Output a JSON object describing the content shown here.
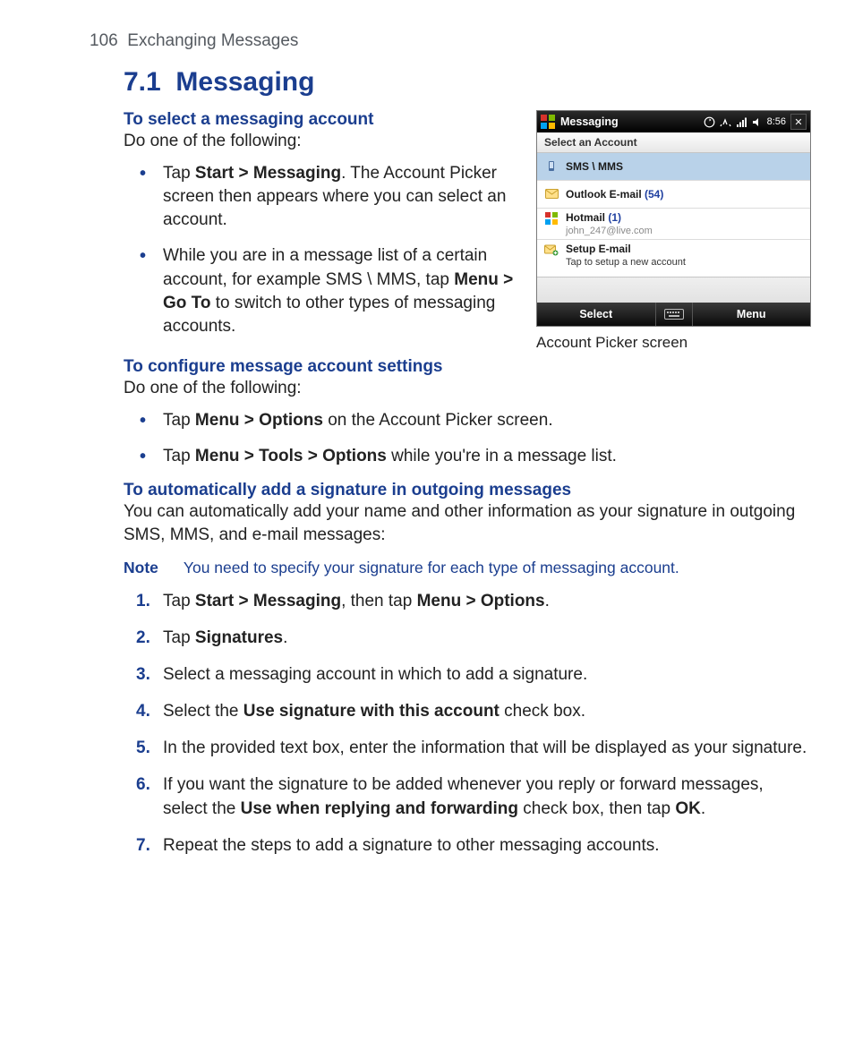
{
  "page": {
    "number": "106",
    "running_head": "Exchanging Messages",
    "section_number": "7.1",
    "section_title": "Messaging"
  },
  "s1": {
    "heading": "To select a messaging account",
    "intro": "Do one of the following:",
    "b1_pre": "Tap ",
    "b1_bold": "Start > Messaging",
    "b1_post": ". The Account Picker screen then appears where you can select an account.",
    "b2_pre": "While you are in a message list of a certain account, for example SMS \\ MMS, tap ",
    "b2_bold": "Menu > Go To",
    "b2_post": " to switch to other types of messaging accounts."
  },
  "shot": {
    "title": "Messaging",
    "time": "8:56",
    "subhead": "Select an Account",
    "rows": {
      "sms": {
        "label": "SMS \\ MMS"
      },
      "outlook": {
        "label_pre": "Outlook E-mail  ",
        "count": "(54)"
      },
      "hotmail": {
        "label_pre": "Hotmail ",
        "count": "(1)",
        "sub": "john_247@live.com"
      },
      "setup": {
        "label": "Setup E-mail",
        "sub": "Tap to setup a new account"
      }
    },
    "soft_left": "Select",
    "soft_right": "Menu",
    "caption": "Account Picker screen"
  },
  "s2": {
    "heading": "To configure message account settings",
    "intro": "Do one of the following:",
    "b1_pre": "Tap ",
    "b1_bold": "Menu > Options",
    "b1_post": " on the Account Picker screen.",
    "b2_pre": "Tap ",
    "b2_bold": "Menu > Tools > Options",
    "b2_post": " while you're in a message list."
  },
  "s3": {
    "heading": "To automatically add a signature in outgoing messages",
    "intro": "You can automatically add your name and other information as your signature in outgoing SMS, MMS, and e-mail messages:",
    "note_label": "Note",
    "note_text": "You need to specify your signature for each type of messaging account.",
    "steps": {
      "n1_pre": "Tap ",
      "n1_b1": "Start > Messaging",
      "n1_mid": ", then tap ",
      "n1_b2": "Menu > Options",
      "n1_post": ".",
      "n2_pre": "Tap ",
      "n2_b1": "Signatures",
      "n2_post": ".",
      "n3": "Select a messaging account in which to add a signature.",
      "n4_pre": "Select the ",
      "n4_b1": "Use signature with this account",
      "n4_post": " check box.",
      "n5": "In the provided text box, enter the information that will be displayed as your signature.",
      "n6_pre": "If you want the signature to be added whenever you reply or forward messages, select the ",
      "n6_b1": "Use when replying and forwarding",
      "n6_mid": " check box, then tap ",
      "n6_b2": "OK",
      "n6_post": ".",
      "n7": "Repeat the steps to add a signature to other messaging accounts."
    }
  }
}
